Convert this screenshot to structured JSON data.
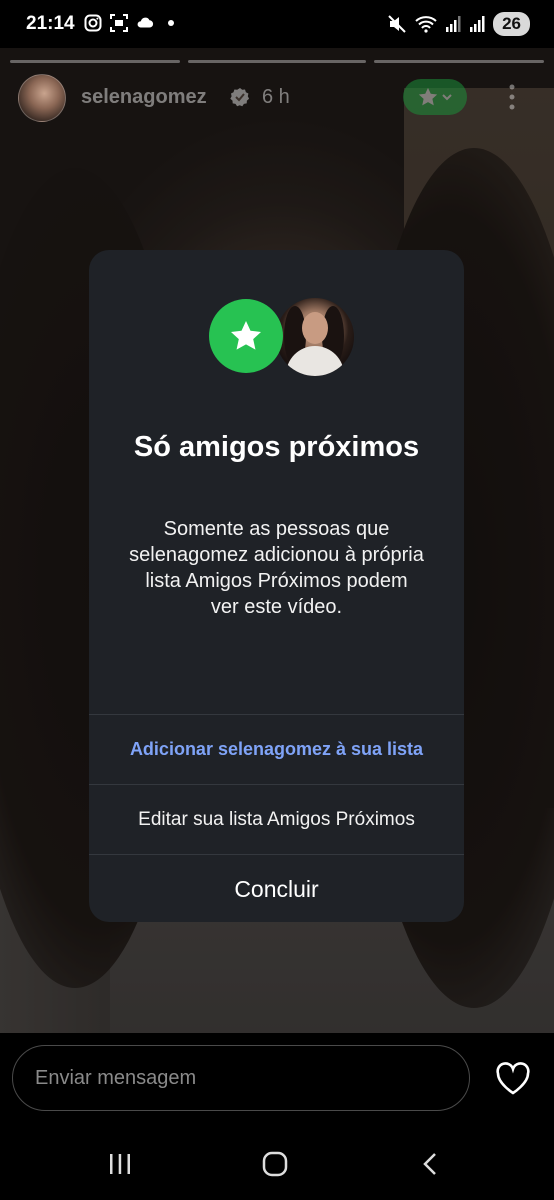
{
  "status_bar": {
    "time": "21:14",
    "battery": "26",
    "left_icons": [
      "instagram-icon",
      "screenshot-icon",
      "cloud-icon",
      "dot-icon"
    ],
    "right_icons": [
      "mute-icon",
      "wifi-icon",
      "signal-icon",
      "signal-icon",
      "battery-icon"
    ]
  },
  "story": {
    "username": "selenagomez",
    "time_ago": "6 h",
    "verified": true,
    "progress_segments": 3,
    "close_friends_badge": "star-icon"
  },
  "modal": {
    "title": "Só amigos próximos",
    "body": "Somente as pessoas que selenagomez adicionou à própria lista Amigos Próximos podem ver este vídeo.",
    "add_button": "Adicionar selenagomez à sua lista",
    "edit_button": "Editar sua lista Amigos Próximos",
    "done_button": "Concluir",
    "accent_color": "#27c252",
    "link_color": "#7fa3f7"
  },
  "message_bar": {
    "placeholder": "Enviar mensagem"
  },
  "nav_bar": {
    "items": [
      "recents-icon",
      "home-icon",
      "back-icon"
    ]
  }
}
